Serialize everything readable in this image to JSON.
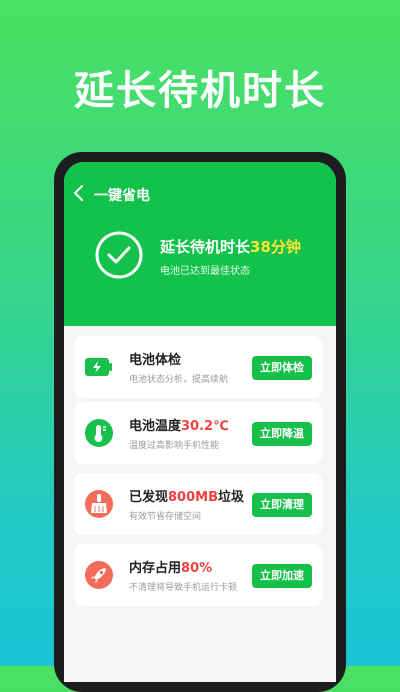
{
  "headline": "延长待机时长",
  "screen": {
    "nav_title": "一键省电",
    "summary": {
      "title_prefix": "延长待机时长",
      "title_highlight": "38分钟",
      "subtitle": "电池已达到最佳状态"
    },
    "cards": [
      {
        "title": "电池体检",
        "highlight": "",
        "desc": "电池状态分析，提高续航",
        "button": "立即体检",
        "icon": "battery-charge-icon"
      },
      {
        "title": "电池温度",
        "highlight": "30.2℃",
        "desc": "温度过高影响手机性能",
        "button": "立即降温",
        "icon": "thermometer-icon"
      },
      {
        "title": "已发现",
        "highlight": "800MB",
        "title_suffix": "垃圾",
        "desc": "有效节省存储空间",
        "button": "立即清理",
        "icon": "broom-icon"
      },
      {
        "title": "内存占用",
        "highlight": "80%",
        "desc": "不清理将导致手机运行卡顿",
        "button": "立即加速",
        "icon": "rocket-icon"
      }
    ]
  },
  "colors": {
    "primary_green": "#12c24a",
    "highlight_yellow": "#ffe437",
    "highlight_red": "#f04141"
  }
}
